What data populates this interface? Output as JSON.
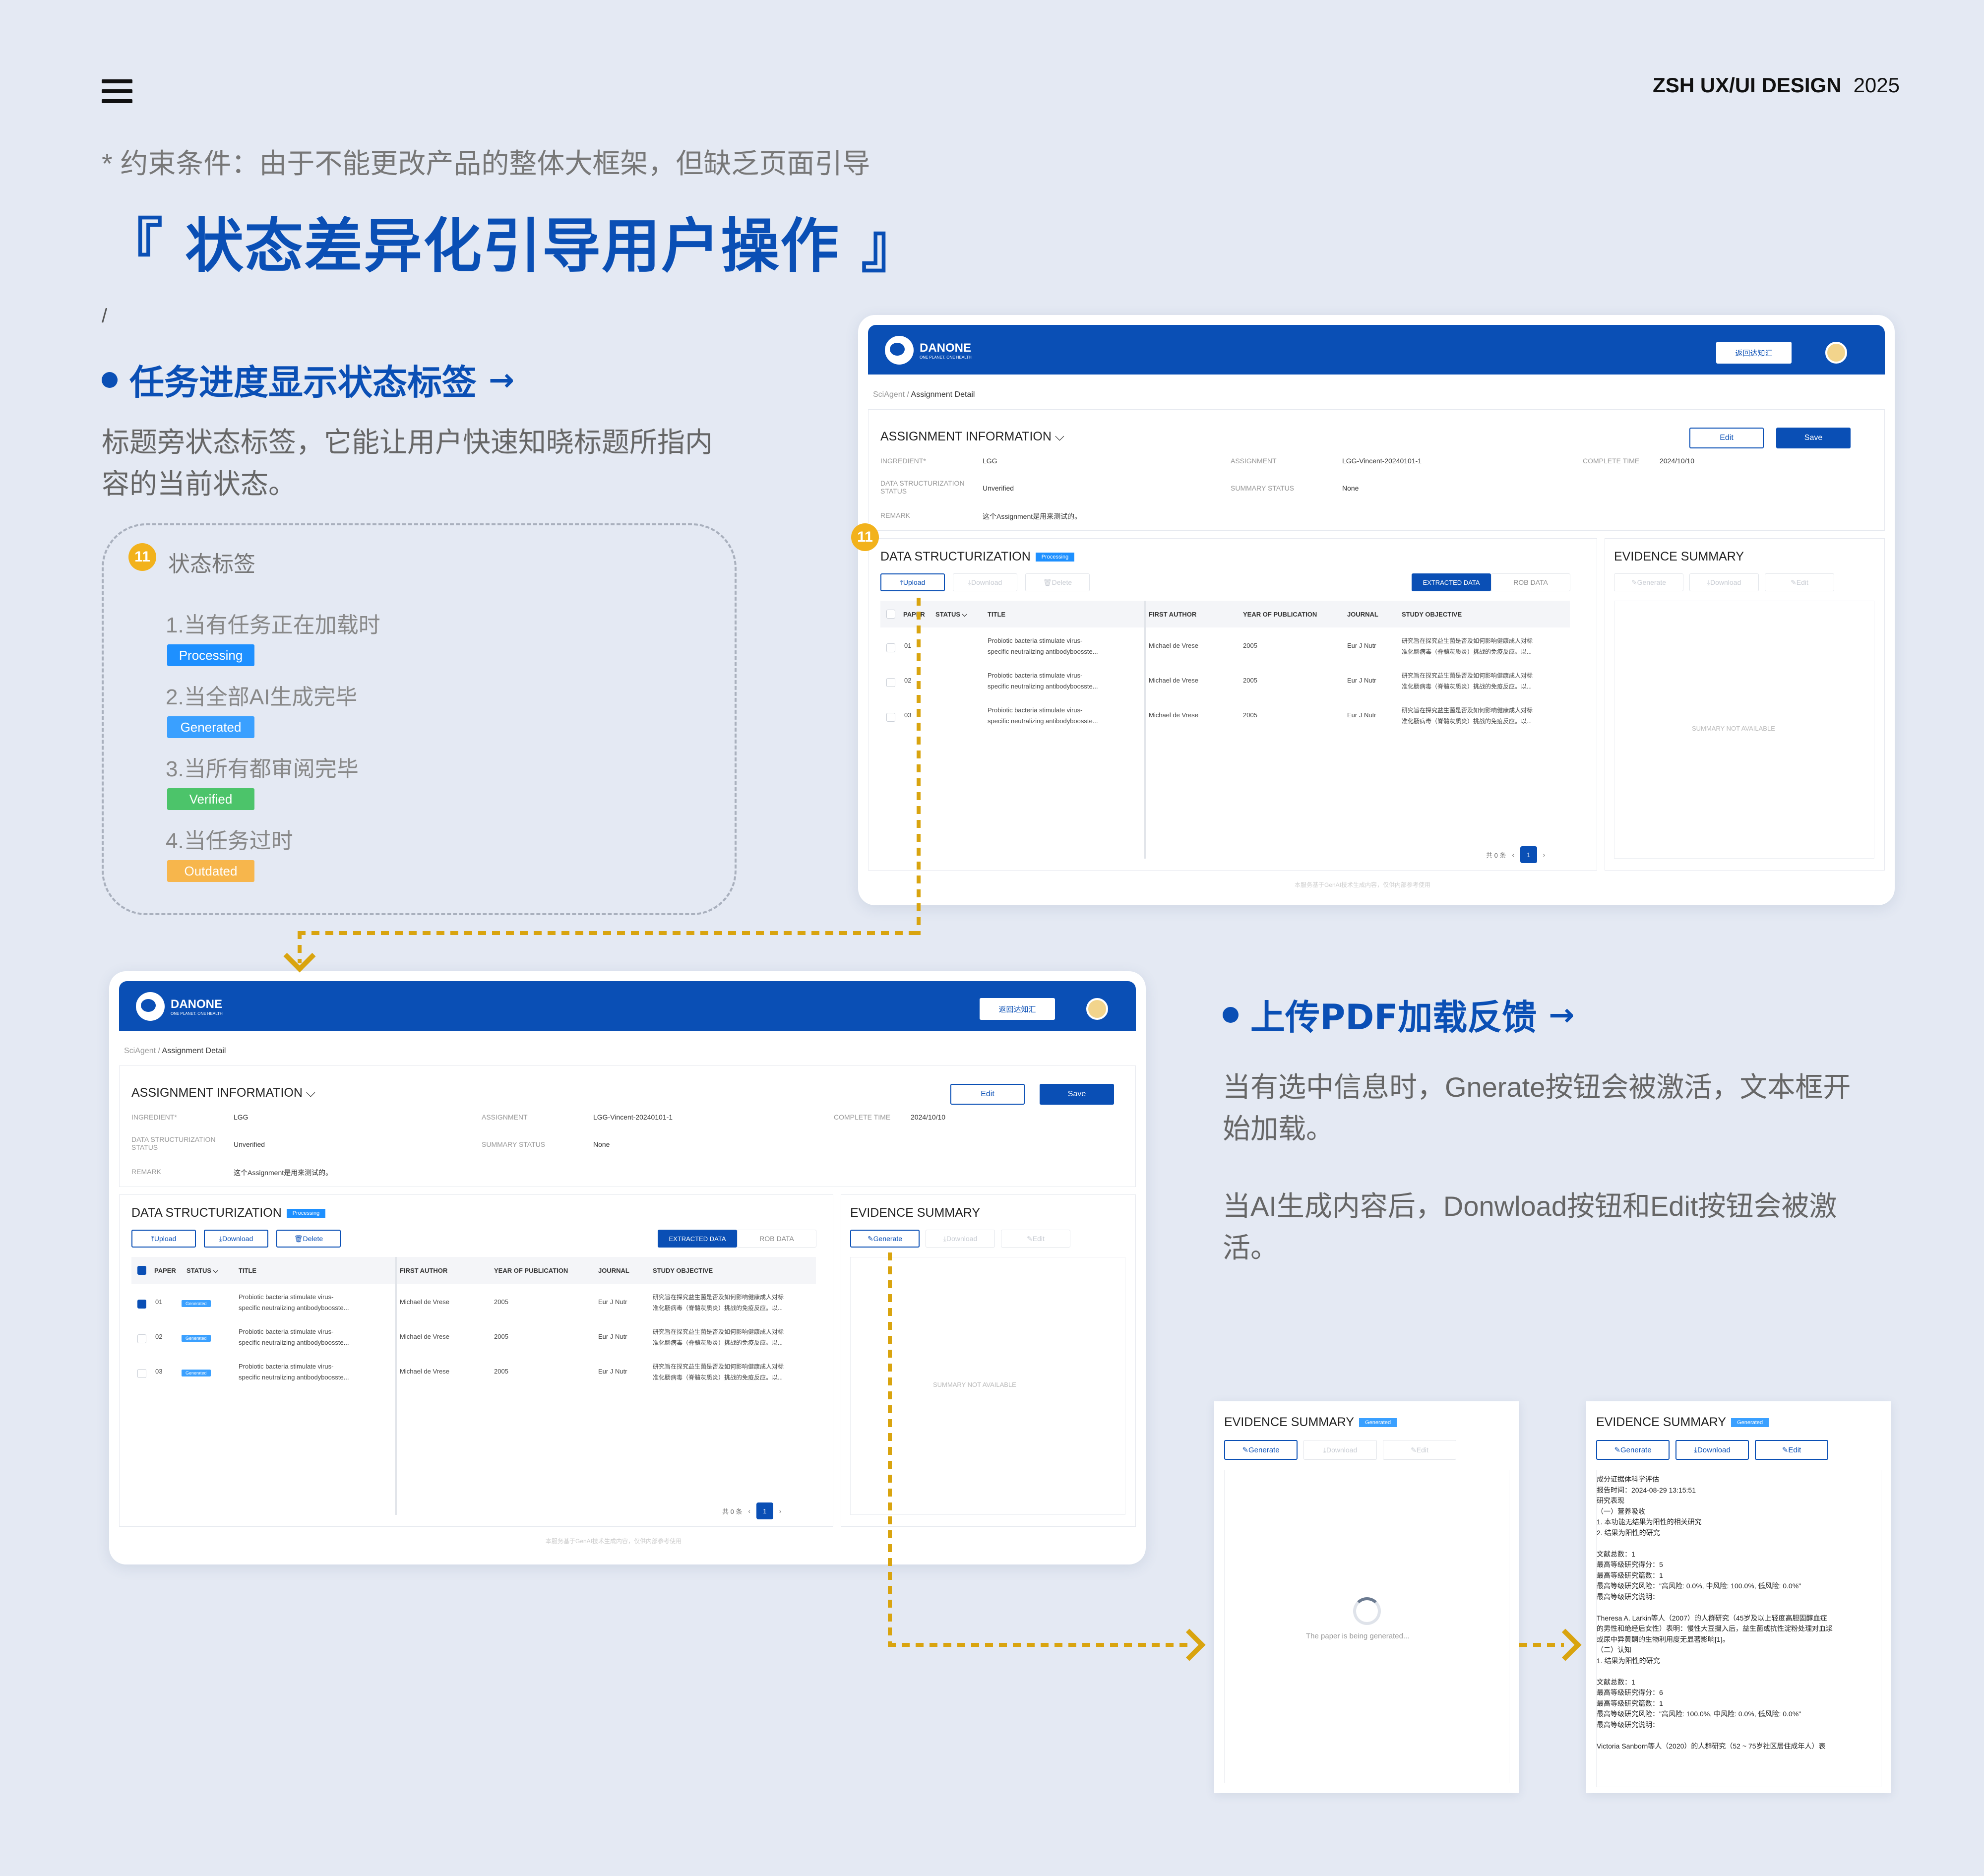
{
  "header": {
    "brand": "ZSH UX/UI DESIGN",
    "year": "2025",
    "constraint": "* 约束条件：由于不能更改产品的整体大框架，但缺乏页面引导",
    "title": "『 状态差异化引导用户操作 』",
    "slash": "/"
  },
  "section1": {
    "heading": "任务进度显示状态标签",
    "arrow": "→",
    "desc_line1": "标题旁状态标签，它能让用户快速知晓标题所指内",
    "desc_line2": "容的当前状态。"
  },
  "legend": {
    "badge": "11",
    "title": "状态标签",
    "items": [
      {
        "text": "1.当有任务正在加载时",
        "tag": "Processing",
        "color": "#1e90ff"
      },
      {
        "text": "2.当全部AI生成完毕",
        "tag": "Generated",
        "color": "#3aa0ff"
      },
      {
        "text": "3.当所有都审阅完毕",
        "tag": "Verified",
        "color": "#4cc46a"
      },
      {
        "text": "4.当任务过时",
        "tag": "Outdated",
        "color": "#f7b64c"
      }
    ]
  },
  "section2": {
    "heading": "上传PDF加载反馈",
    "arrow": "→",
    "p1_line1": "当有选中信息时，Gnerate按钮会被激活，文本框开",
    "p1_line2": "始加载。",
    "p2_line1": "当AI生成内容后，Donwload按钮和Edit按钮会被激",
    "p2_line2": "活。"
  },
  "app": {
    "logo": "DANONE",
    "logo_sub": "ONE PLANET. ONE HEALTH",
    "back_btn": "返回达知汇",
    "crumb_root": "SciAgent",
    "crumb_sep": "/",
    "crumb_current": "Assignment Detail",
    "info_title": "ASSIGNMENT INFORMATION",
    "edit": "Edit",
    "save": "Save",
    "ingredient_label": "INGREDIENT*",
    "ingredient": "LGG",
    "assignment_label": "ASSIGNMENT",
    "assignment": "LGG-Vincent-20240101-1",
    "complete_label": "COMPLETE TIME",
    "complete": "2024/10/10",
    "dss_label": "DATA STRUCTURIZATION STATUS",
    "dss": "Unverified",
    "summary_status_label": "SUMMARY STATUS",
    "summary_status": "None",
    "remark_label": "REMARK",
    "remark": "这个Assignment是用来测试的。",
    "ds_title": "DATA STRUCTURIZATION",
    "ds_tag": "Processing",
    "upload": "Upload",
    "download": "Download",
    "delete": "Delete",
    "tab_extracted": "EXTRACTED DATA",
    "tab_rob": "ROB DATA",
    "cols": [
      "PAPER",
      "STATUS",
      "TITLE",
      "FIRST AUTHOR",
      "YEAR OF PUBLICATION",
      "JOURNAL",
      "STUDY OBJECTIVE"
    ],
    "rows": [
      {
        "paper": "01",
        "title1": "Probiotic bacteria stimulate virus-",
        "title2": "specific neutralizing antibodyboosste...",
        "author": "Michael de Vrese",
        "year": "2005",
        "journal": "Eur J Nutr",
        "obj1": "研究旨在探究益生菌是否及如何影响健康成人对标",
        "obj2": "准化肠病毒（脊髓灰质炎）挑战的免疫反应。以..."
      },
      {
        "paper": "02",
        "title1": "Probiotic bacteria stimulate virus-",
        "title2": "specific neutralizing antibodyboosste...",
        "author": "Michael de Vrese",
        "year": "2005",
        "journal": "Eur J Nutr",
        "obj1": "研究旨在探究益生菌是否及如何影响健康成人对标",
        "obj2": "准化肠病毒（脊髓灰质炎）挑战的免疫反应。以..."
      },
      {
        "paper": "03",
        "title1": "Probiotic bacteria stimulate virus-",
        "title2": "specific neutralizing antibodyboosste...",
        "author": "Michael de Vrese",
        "year": "2005",
        "journal": "Eur J Nutr",
        "obj1": "研究旨在探究益生菌是否及如何影响健康成人对标",
        "obj2": "准化肠病毒（脊髓灰质炎）挑战的免疫反应。以..."
      }
    ],
    "row_tag": "Generated",
    "total": "共 0 条",
    "page": "1",
    "ev_title": "EVIDENCE SUMMARY",
    "generate": "Generate",
    "no_summary": "SUMMARY NOT AVAILABLE",
    "footer": "本服务基于GenAI技术生成内容，仅供内部参考使用"
  },
  "ev_panels": {
    "title": "EVIDENCE SUMMARY",
    "tag": "Generated",
    "generate": "Generate",
    "download": "Download",
    "edit": "Edit",
    "loading": "The paper is being generated...",
    "content": "成分证据体科学评估\n报告时间：2024-08-29 13:15:51\n研究表现\n（一）营养吸收\n1. 本功能无结果为阳性的相关研究\n2. 结果为阳性的研究\n\n文献总数：1\n最高等级研究得分：5\n最高等级研究篇数：1\n最高等级研究风险：\"高风险: 0.0%, 中风险: 100.0%, 低风险: 0.0%\"\n最高等级研究说明：\n\nTheresa A. Larkin等人（2007）的人群研究（45岁及以上轻度高胆固醇血症\n的男性和绝经后女性）表明：慢性大豆摄入后，益生菌或抗性淀粉处理对血浆\n或尿中异黄酮的生物利用度无显著影响[1]。\n（二）认知\n1. 结果为阳性的研究\n\n文献总数：1\n最高等级研究得分：6\n最高等级研究篇数：1\n最高等级研究风险：\"高风险: 100.0%, 中风险: 0.0%, 低风险: 0.0%\"\n最高等级研究说明：\n\nVictoria Sanborn等人（2020）的人群研究（52 ~ 75岁社区居住成年人）表"
  }
}
